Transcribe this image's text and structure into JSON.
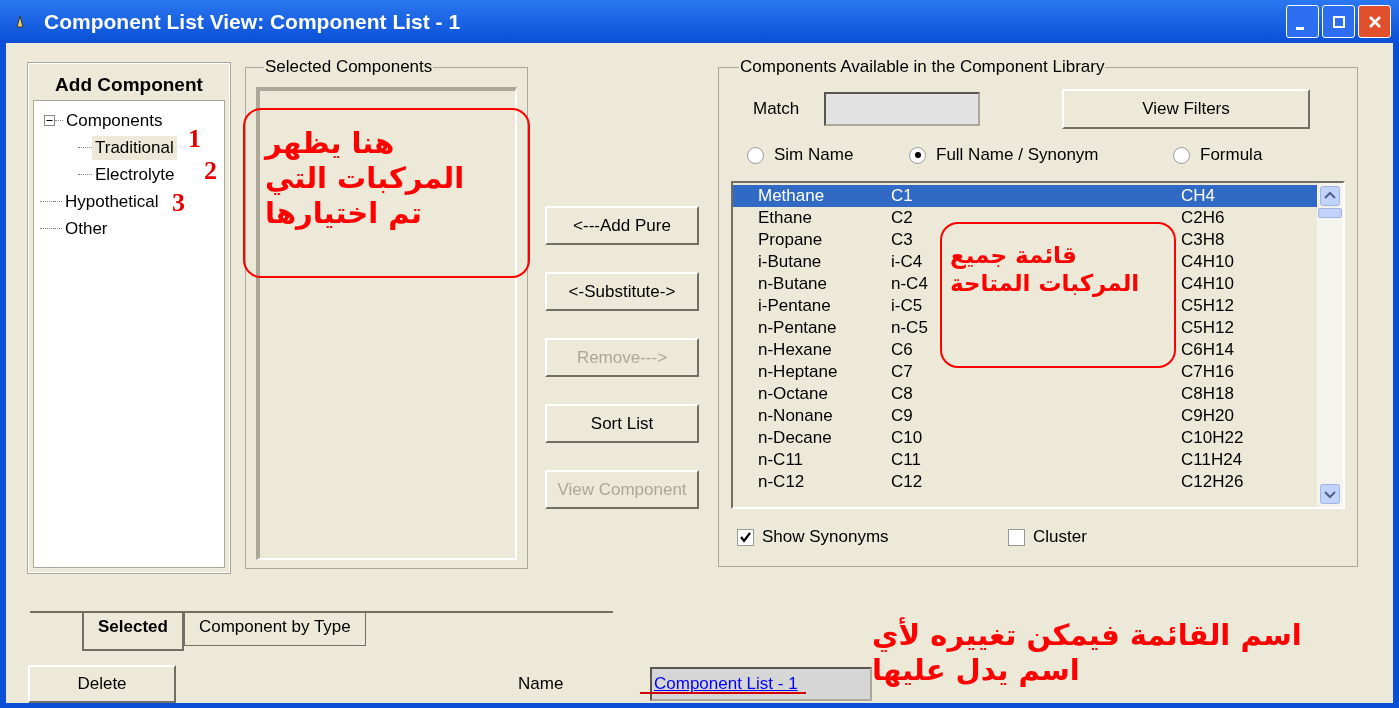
{
  "window": {
    "title": "Component List View: Component List - 1"
  },
  "add_component": {
    "title": "Add Component",
    "tree": [
      {
        "label": "Components",
        "expanded": true,
        "selected": false,
        "children": [
          {
            "label": "Traditional",
            "selected": true
          },
          {
            "label": "Electrolyte",
            "selected": false
          }
        ]
      },
      {
        "label": "Hypothetical",
        "selected": false
      },
      {
        "label": "Other",
        "selected": false
      }
    ]
  },
  "selected_components": {
    "title": "Selected Components"
  },
  "action_buttons": [
    {
      "label": "<---Add Pure",
      "disabled": false
    },
    {
      "label": "<-Substitute->",
      "disabled": false
    },
    {
      "label": "Remove--->",
      "disabled": true
    },
    {
      "label": "Sort List",
      "disabled": false
    },
    {
      "label": "View Component",
      "disabled": true
    }
  ],
  "library": {
    "title": "Components Available in the Component Library",
    "match": {
      "label": "Match"
    },
    "view_filters": "View Filters",
    "radios": [
      {
        "label": "Sim Name",
        "selected": false
      },
      {
        "label": "Full Name / Synonym",
        "selected": true
      },
      {
        "label": "Formula",
        "selected": false
      }
    ],
    "rows": [
      {
        "name": "Methane",
        "sim_name": "C1",
        "formula": "CH4",
        "selected": true
      },
      {
        "name": "Ethane",
        "sim_name": "C2",
        "formula": "C2H6",
        "selected": false
      },
      {
        "name": "Propane",
        "sim_name": "C3",
        "formula": "C3H8",
        "selected": false
      },
      {
        "name": "i-Butane",
        "sim_name": "i-C4",
        "formula": "C4H10",
        "selected": false
      },
      {
        "name": "n-Butane",
        "sim_name": "n-C4",
        "formula": "C4H10",
        "selected": false
      },
      {
        "name": "i-Pentane",
        "sim_name": "i-C5",
        "formula": "C5H12",
        "selected": false
      },
      {
        "name": "n-Pentane",
        "sim_name": "n-C5",
        "formula": "C5H12",
        "selected": false
      },
      {
        "name": "n-Hexane",
        "sim_name": "C6",
        "formula": "C6H14",
        "selected": false
      },
      {
        "name": "n-Heptane",
        "sim_name": "C7",
        "formula": "C7H16",
        "selected": false
      },
      {
        "name": "n-Octane",
        "sim_name": "C8",
        "formula": "C8H18",
        "selected": false
      },
      {
        "name": "n-Nonane",
        "sim_name": "C9",
        "formula": "C9H20",
        "selected": false
      },
      {
        "name": "n-Decane",
        "sim_name": "C10",
        "formula": "C10H22",
        "selected": false
      },
      {
        "name": "n-C11",
        "sim_name": "C11",
        "formula": "C11H24",
        "selected": false
      },
      {
        "name": "n-C12",
        "sim_name": "C12",
        "formula": "C12H26",
        "selected": false
      }
    ],
    "options": [
      {
        "label": "Show Synonyms",
        "checked": true
      },
      {
        "label": "Cluster",
        "checked": false
      }
    ]
  },
  "tabs": [
    {
      "label": "Selected",
      "selected": true
    },
    {
      "label": "Component by Type",
      "selected": false
    }
  ],
  "delete_button": "Delete",
  "name_field": {
    "label": "Name",
    "value": "Component List - 1"
  },
  "annotations": [
    {
      "kind": "number",
      "text": "1"
    },
    {
      "kind": "number",
      "text": "2"
    },
    {
      "kind": "number",
      "text": "3"
    },
    {
      "kind": "note",
      "text": "هنا يظهر المركبات التي تم اختيارها",
      "boxed": true
    },
    {
      "kind": "note",
      "text": "قائمة جميع المركبات المتاحة",
      "boxed": true
    },
    {
      "kind": "note",
      "text": "اسم القائمة فيمكن تغييره لأي اسم يدل عليها",
      "boxed": false
    },
    {
      "kind": "underline"
    }
  ]
}
